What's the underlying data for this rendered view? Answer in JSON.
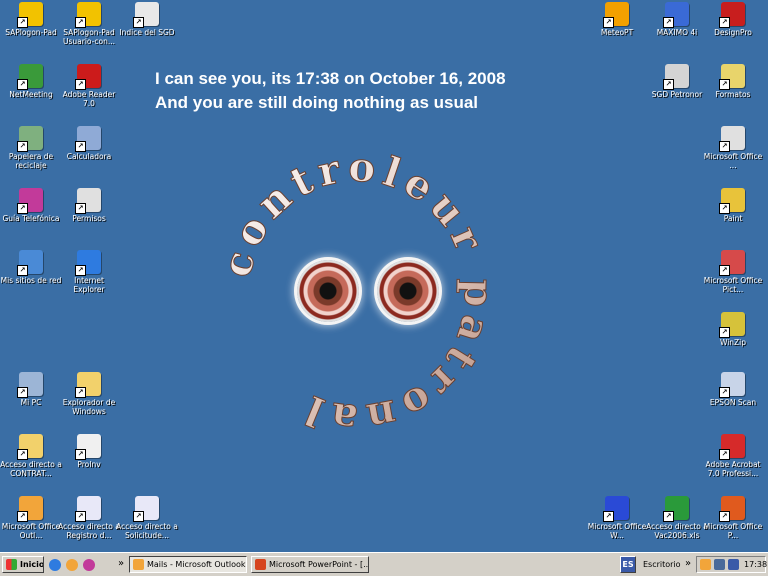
{
  "desktop": {
    "background": "#3a6ea5",
    "message": {
      "line1": "I can see you, its 17:38 on October 16, 2008",
      "line2": "And you are still doing nothing as usual"
    },
    "ring_text": "controleur patronal",
    "icons_left": [
      {
        "label": "SAPlogon-Pad",
        "icon": "sap-pad-icon",
        "color": "#f2c200"
      },
      {
        "label": "SAPlogon-Pad Usuario-con...",
        "icon": "sap-pad-icon",
        "color": "#f2c200"
      },
      {
        "label": "Indice del SGD",
        "icon": "document-index-icon",
        "color": "#e8e8e8"
      },
      {
        "label": "NetMeeting",
        "icon": "netmeeting-icon",
        "color": "#3a9a3a"
      },
      {
        "label": "Adobe Reader 7.0",
        "icon": "adobe-reader-icon",
        "color": "#cc1b1b"
      },
      {
        "label": "Papelera de reciclaje",
        "icon": "recycle-bin-icon",
        "color": "#7fb07f"
      },
      {
        "label": "Calculadora",
        "icon": "calculator-icon",
        "color": "#8faad6"
      },
      {
        "label": "Guía Telefónica",
        "icon": "phone-book-icon",
        "color": "#c23a9a"
      },
      {
        "label": "Permisos",
        "icon": "permissions-icon",
        "color": "#e0e0e0"
      },
      {
        "label": "Mis sitios de red",
        "icon": "network-places-icon",
        "color": "#4a8ad6"
      },
      {
        "label": "Internet Explorer",
        "icon": "internet-explorer-icon",
        "color": "#2e7be0"
      },
      {
        "label": "Mi PC",
        "icon": "my-computer-icon",
        "color": "#9cb5d6"
      },
      {
        "label": "Explorador de Windows",
        "icon": "windows-explorer-icon",
        "color": "#f2d16b"
      },
      {
        "label": "Acceso directo a CONTRAT...",
        "icon": "folder-icon",
        "color": "#f2d16b"
      },
      {
        "label": "ProInv",
        "icon": "proinv-icon",
        "color": "#f0f0f0"
      },
      {
        "label": "Microsoft Office Outl...",
        "icon": "office-outlook-icon",
        "color": "#f2a53a"
      },
      {
        "label": "Acceso directo a Registro d...",
        "icon": "pdf-shortcut-icon",
        "color": "#e8e8f8"
      },
      {
        "label": "Acceso directo a Solicitude...",
        "icon": "pdf-shortcut-icon",
        "color": "#e8e8f8"
      }
    ],
    "icons_right": [
      {
        "label": "MeteoPT",
        "icon": "meteo-sun-icon",
        "color": "#f2a000"
      },
      {
        "label": "MAXIMO 4i",
        "icon": "maximo-icon",
        "color": "#3a6ad6"
      },
      {
        "label": "DesignPro",
        "icon": "designpro-icon",
        "color": "#c81e1e"
      },
      {
        "label": "SGD Petronor",
        "icon": "sgd-icon",
        "color": "#d4d4d4"
      },
      {
        "label": "Formatos",
        "icon": "formats-icon",
        "color": "#e8d46b"
      },
      {
        "label": "Microsoft Office ...",
        "icon": "office-icon",
        "color": "#e0e0e0"
      },
      {
        "label": "Paint",
        "icon": "paint-icon",
        "color": "#e8c33a"
      },
      {
        "label": "Microsoft Office Pict...",
        "icon": "office-picture-icon",
        "color": "#d64a4a"
      },
      {
        "label": "WinZip",
        "icon": "winzip-icon",
        "color": "#d6c23a"
      },
      {
        "label": "EPSON Scan",
        "icon": "scanner-icon",
        "color": "#c8d4e8"
      },
      {
        "label": "Adobe Acrobat 7.0 Professi...",
        "icon": "acrobat-icon",
        "color": "#d62a2a"
      },
      {
        "label": "Microsoft Office W...",
        "icon": "office-word-icon",
        "color": "#2a4ad6"
      },
      {
        "label": "Acceso directo a Vac2006.xls",
        "icon": "excel-shortcut-icon",
        "color": "#2a9a3a"
      },
      {
        "label": "Microsoft Office P...",
        "icon": "office-powerpoint-icon",
        "color": "#e05a1e"
      }
    ]
  },
  "taskbar": {
    "start_label": "Inicio",
    "chevron": "»",
    "tasks": [
      {
        "label": "Mails - Microsoft Outlook",
        "icon": "outlook-icon",
        "color": "#f2a53a"
      },
      {
        "label": "Microsoft PowerPoint - [...",
        "icon": "powerpoint-icon",
        "color": "#d6441e"
      }
    ],
    "lang": "ES",
    "desktop_label": "Escritorio",
    "clock": "17:38"
  }
}
